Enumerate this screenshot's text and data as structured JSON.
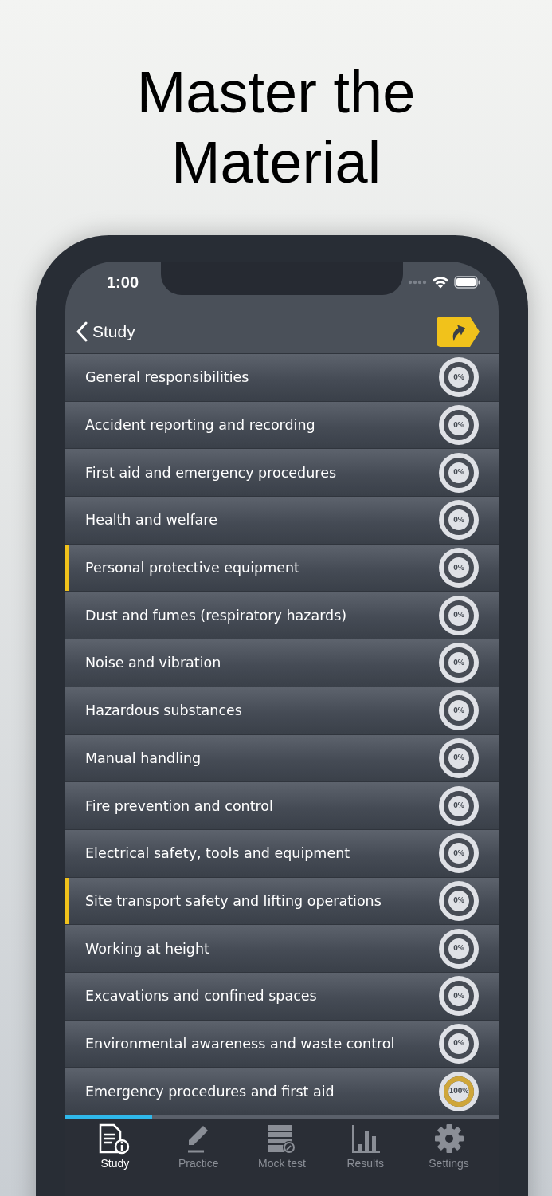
{
  "headline": "Master the Material",
  "status_bar": {
    "time": "1:00"
  },
  "nav": {
    "back_label": "Study"
  },
  "topics": [
    {
      "title": "General responsibilities",
      "marked": false,
      "level": 0,
      "percent": "0%"
    },
    {
      "title": "Accident reporting and recording",
      "marked": false,
      "level": 0,
      "percent": "0%"
    },
    {
      "title": "First aid and emergency procedures",
      "marked": false,
      "level": 0,
      "percent": "0%"
    },
    {
      "title": "Health and welfare",
      "marked": false,
      "level": 0,
      "percent": "0%"
    },
    {
      "title": "Personal protective equipment",
      "marked": true,
      "level": 0,
      "percent": "0%"
    },
    {
      "title": "Dust and fumes (respiratory hazards)",
      "marked": false,
      "level": 0,
      "percent": "0%"
    },
    {
      "title": "Noise and vibration",
      "marked": false,
      "level": 0,
      "percent": "0%"
    },
    {
      "title": "Hazardous substances",
      "marked": false,
      "level": 0,
      "percent": "0%"
    },
    {
      "title": "Manual handling",
      "marked": false,
      "level": 0,
      "percent": "0%"
    },
    {
      "title": "Fire prevention and control",
      "marked": false,
      "level": 0,
      "percent": "0%"
    },
    {
      "title": "Electrical safety, tools and equipment",
      "marked": false,
      "level": 0,
      "percent": "0%"
    },
    {
      "title": "Site transport safety and lifting operations",
      "marked": true,
      "level": 0,
      "percent": "0%"
    },
    {
      "title": "Working at height",
      "marked": false,
      "level": 0,
      "percent": "0%"
    },
    {
      "title": "Excavations and confined spaces",
      "marked": false,
      "level": 0,
      "percent": "0%"
    },
    {
      "title": "Environmental awareness and waste control",
      "marked": false,
      "level": 0,
      "percent": "0%"
    },
    {
      "title": "Emergency procedures and first aid",
      "marked": false,
      "level": 1,
      "percent": "100%"
    }
  ],
  "scroll_progress": {
    "level": 0.2
  },
  "tabs": [
    {
      "label": "Study",
      "selected": true
    },
    {
      "label": "Practice",
      "selected": false
    },
    {
      "label": "Mock test",
      "selected": false
    },
    {
      "label": "Results",
      "selected": false
    },
    {
      "label": "Settings",
      "selected": false
    }
  ]
}
